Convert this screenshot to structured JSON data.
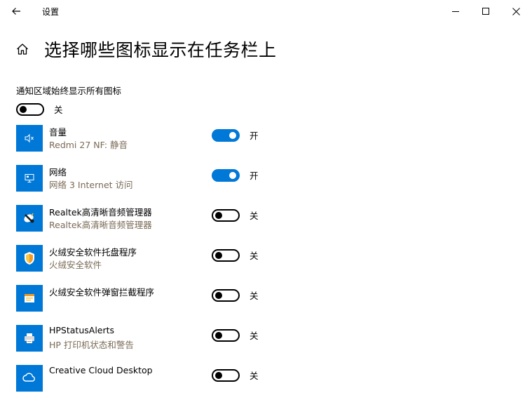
{
  "window": {
    "title": "设置",
    "controls": {
      "minimize": "minimize-icon",
      "maximize": "maximize-icon",
      "close": "close-icon"
    }
  },
  "header": {
    "title": "选择哪些图标显示在任务栏上"
  },
  "always_show": {
    "label": "通知区域始终显示所有图标",
    "state": false,
    "state_label": "关"
  },
  "apps": [
    {
      "name": "音量",
      "desc": "Redmi 27 NF: 静音",
      "state": true,
      "state_label": "开",
      "icon": "volume-icon"
    },
    {
      "name": "网络",
      "desc": "网络 3 Internet 访问",
      "state": true,
      "state_label": "开",
      "icon": "network-icon"
    },
    {
      "name": "Realtek高清晰音频管理器",
      "desc": "Realtek高清晰音频管理器",
      "state": false,
      "state_label": "关",
      "icon": "realtek-icon"
    },
    {
      "name": "火绒安全软件托盘程序",
      "desc": "火绒安全软件",
      "state": false,
      "state_label": "关",
      "icon": "shield-icon"
    },
    {
      "name": "火绒安全软件弹窗拦截程序",
      "desc": "",
      "state": false,
      "state_label": "关",
      "icon": "popup-blocker-icon"
    },
    {
      "name": "HPStatusAlerts",
      "desc": "HP 打印机状态和警告",
      "state": false,
      "state_label": "关",
      "icon": "printer-icon"
    },
    {
      "name": "Creative Cloud Desktop",
      "desc": "",
      "state": false,
      "state_label": "关",
      "icon": "creative-cloud-icon"
    }
  ],
  "colors": {
    "accent": "#0078d7",
    "desc_text": "#7a6a55",
    "text": "#000000",
    "background": "#ffffff"
  }
}
